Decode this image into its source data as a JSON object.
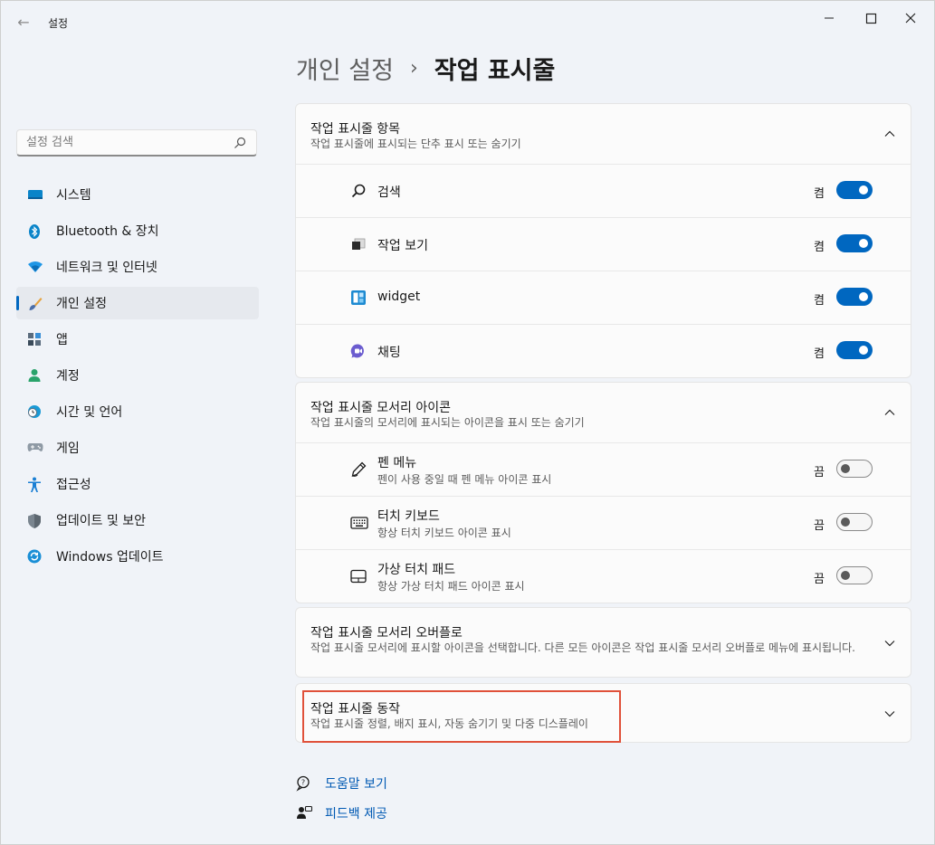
{
  "window": {
    "back_glyph": "←",
    "title": "설정",
    "controls": {
      "minimize": "—",
      "maximize": "☐",
      "close": "✕"
    }
  },
  "breadcrumb": {
    "parent": "개인 설정",
    "separator": "›",
    "current": "작업 표시줄"
  },
  "search": {
    "placeholder": "설정 검색",
    "value": ""
  },
  "sidebar": {
    "items": [
      {
        "label": "시스템",
        "icon": "monitor-icon"
      },
      {
        "label": "Bluetooth & 장치",
        "icon": "bluetooth-icon"
      },
      {
        "label": "네트워크 및 인터넷",
        "icon": "wifi-icon"
      },
      {
        "label": "개인 설정",
        "icon": "brush-icon",
        "selected": true
      },
      {
        "label": "앱",
        "icon": "apps-icon"
      },
      {
        "label": "계정",
        "icon": "account-icon"
      },
      {
        "label": "시간 및 언어",
        "icon": "clock-globe-icon"
      },
      {
        "label": "게임",
        "icon": "gamepad-icon"
      },
      {
        "label": "접근성",
        "icon": "accessibility-icon"
      },
      {
        "label": "업데이트 및 보안",
        "icon": "shield-icon"
      },
      {
        "label": "Windows 업데이트",
        "icon": "update-icon"
      }
    ]
  },
  "sections": {
    "taskbar_items": {
      "title": "작업 표시줄 항목",
      "description": "작업 표시줄에 표시되는 단추 표시 또는 숨기기",
      "expanded": true,
      "rows": [
        {
          "label": "검색",
          "state": "켬",
          "on": true,
          "icon": "search-icon"
        },
        {
          "label": "작업 보기",
          "state": "켬",
          "on": true,
          "icon": "task-view-icon"
        },
        {
          "label": "widget",
          "state": "켬",
          "on": true,
          "icon": "widgets-icon"
        },
        {
          "label": "채팅",
          "state": "켬",
          "on": true,
          "icon": "chat-icon"
        }
      ]
    },
    "corner_icons": {
      "title": "작업 표시줄 모서리 아이콘",
      "description": "작업 표시줄의 모서리에 표시되는 아이콘을 표시 또는 숨기기",
      "expanded": true,
      "rows": [
        {
          "label": "펜 메뉴",
          "sub": "펜이 사용 중일 때 펜 메뉴 아이콘 표시",
          "state": "끔",
          "on": false,
          "icon": "pen-icon"
        },
        {
          "label": "터치 키보드",
          "sub": "항상 터치 키보드 아이콘 표시",
          "state": "끔",
          "on": false,
          "icon": "keyboard-icon"
        },
        {
          "label": "가상 터치 패드",
          "sub": "항상 가상 터치 패드 아이콘 표시",
          "state": "끔",
          "on": false,
          "icon": "touchpad-icon"
        }
      ]
    },
    "corner_overflow": {
      "title": "작업 표시줄 모서리 오버플로",
      "description": "작업 표시줄 모서리에 표시할 아이콘을 선택합니다. 다른 모든 아이콘은 작업 표시줄 모서리 오버플로 메뉴에 표시됩니다.",
      "expanded": false
    },
    "behaviors": {
      "title": "작업 표시줄 동작",
      "description": "작업 표시줄 정렬, 배지 표시, 자동 숨기기 및 다중 디스플레이",
      "expanded": false,
      "highlighted": true,
      "highlight_color": "#e0513a"
    }
  },
  "links": {
    "help": {
      "label": "도움말 보기",
      "icon": "help-icon"
    },
    "feedback": {
      "label": "피드백 제공",
      "icon": "feedback-icon"
    }
  },
  "colors": {
    "accent": "#0067c0",
    "highlight": "#e0513a",
    "link": "#0059b3"
  }
}
